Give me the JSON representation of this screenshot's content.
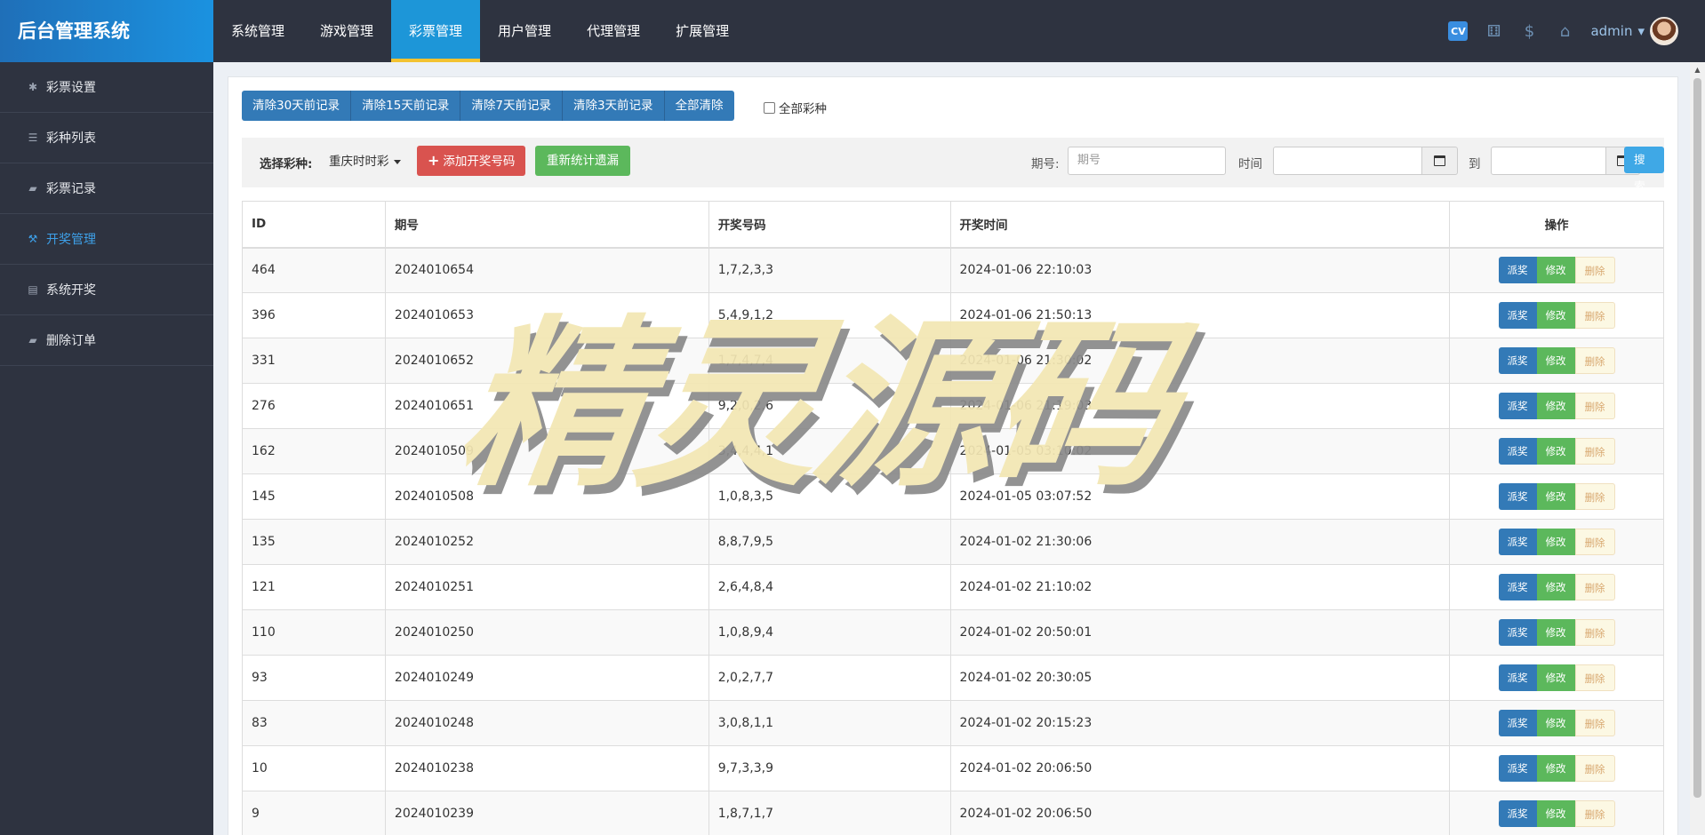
{
  "brand": {
    "title": "后台管理系统"
  },
  "topnav": {
    "items": [
      {
        "label": "系统管理"
      },
      {
        "label": "游戏管理"
      },
      {
        "label": "彩票管理"
      },
      {
        "label": "用户管理"
      },
      {
        "label": "代理管理"
      },
      {
        "label": "扩展管理"
      }
    ],
    "active_index": 2
  },
  "topright": {
    "cv_badge": "CV",
    "gift_icon": "⚅",
    "dollar_icon": "$",
    "home_icon": "⌂",
    "username": "admin",
    "caret": "▾"
  },
  "sidebar": {
    "items": [
      {
        "label": "彩票设置",
        "icon": "✱"
      },
      {
        "label": "彩种列表",
        "icon": "☰"
      },
      {
        "label": "彩票记录",
        "icon": "▰"
      },
      {
        "label": "开奖管理",
        "icon": "⚒"
      },
      {
        "label": "系统开奖",
        "icon": "▤"
      },
      {
        "label": "删除订单",
        "icon": "▰"
      }
    ],
    "active_index": 3
  },
  "clear_buttons": {
    "b30": "清除30天前记录",
    "b15": "清除15天前记录",
    "b7": "清除7天前记录",
    "b3": "清除3天前记录",
    "all": "全部清除"
  },
  "all_lottery_checkbox": {
    "label": "全部彩种",
    "checked": false
  },
  "filter": {
    "select_label": "选择彩种:",
    "select_value": "重庆时时彩",
    "add_button": "添加开奖号码",
    "add_icon": "+",
    "recount_button": "重新统计遗漏",
    "issue_label": "期号:",
    "issue_placeholder": "期号",
    "time_label": "时间",
    "to_label": "到",
    "search_button": "搜索"
  },
  "table": {
    "headers": {
      "id": "ID",
      "issue": "期号",
      "numbers": "开奖号码",
      "time": "开奖时间",
      "ops": "操作"
    },
    "op_labels": {
      "pai": "派奖",
      "edit": "修改",
      "del": "删除"
    },
    "rows": [
      {
        "id": "464",
        "issue": "2024010654",
        "numbers": "1,7,2,3,3",
        "time": "2024-01-06 22:10:03"
      },
      {
        "id": "396",
        "issue": "2024010653",
        "numbers": "5,4,9,1,2",
        "time": "2024-01-06 21:50:13"
      },
      {
        "id": "331",
        "issue": "2024010652",
        "numbers": "1,7,4,7,4",
        "time": "2024-01-06 21:30:02"
      },
      {
        "id": "276",
        "issue": "2024010651",
        "numbers": "9,2,0,2,6",
        "time": "2024-01-06 21:19:03"
      },
      {
        "id": "162",
        "issue": "2024010509",
        "numbers": "3,4,4,4,1",
        "time": "2024-01-05 03:10:02"
      },
      {
        "id": "145",
        "issue": "2024010508",
        "numbers": "1,0,8,3,5",
        "time": "2024-01-05 03:07:52"
      },
      {
        "id": "135",
        "issue": "2024010252",
        "numbers": "8,8,7,9,5",
        "time": "2024-01-02 21:30:06"
      },
      {
        "id": "121",
        "issue": "2024010251",
        "numbers": "2,6,4,8,4",
        "time": "2024-01-02 21:10:02"
      },
      {
        "id": "110",
        "issue": "2024010250",
        "numbers": "1,0,8,9,4",
        "time": "2024-01-02 20:50:01"
      },
      {
        "id": "93",
        "issue": "2024010249",
        "numbers": "2,0,2,7,7",
        "time": "2024-01-02 20:30:05"
      },
      {
        "id": "83",
        "issue": "2024010248",
        "numbers": "3,0,8,1,1",
        "time": "2024-01-02 20:15:23"
      },
      {
        "id": "10",
        "issue": "2024010238",
        "numbers": "9,7,3,3,9",
        "time": "2024-01-02 20:06:50"
      },
      {
        "id": "9",
        "issue": "2024010239",
        "numbers": "1,8,7,1,7",
        "time": "2024-01-02 20:06:50"
      }
    ]
  },
  "watermark": {
    "text": "精灵源码"
  },
  "colors": {
    "topbar": "#2e3340",
    "brand": "#1b92e0",
    "active_tab": "#1d96d8",
    "active_tab_underline": "#f3c230",
    "primary": "#337ab7",
    "success": "#5cb85c",
    "danger": "#d9534f",
    "search": "#3fa8e6"
  }
}
